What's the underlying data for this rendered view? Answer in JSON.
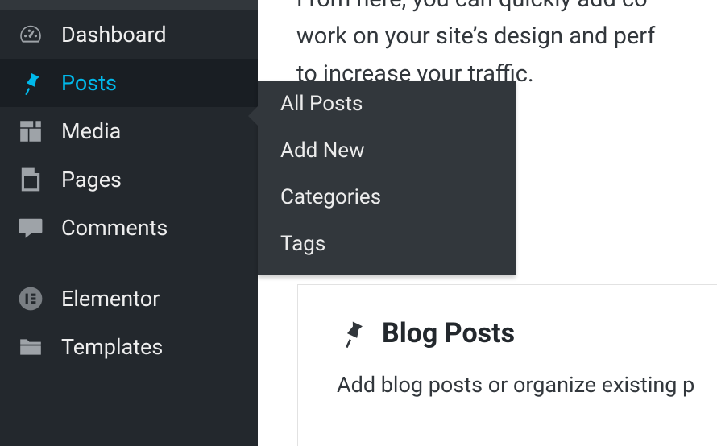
{
  "sidebar": {
    "items": [
      {
        "label": "Dashboard"
      },
      {
        "label": "Posts"
      },
      {
        "label": "Media"
      },
      {
        "label": "Pages"
      },
      {
        "label": "Comments"
      },
      {
        "label": "Elementor"
      },
      {
        "label": "Templates"
      }
    ]
  },
  "submenu": {
    "items": [
      "All Posts",
      "Add New",
      "Categories",
      "Tags"
    ]
  },
  "intro": {
    "line1": "From here, you can quickly add co",
    "line2": "work on your site’s design and perf",
    "line3": "to increase your traffic."
  },
  "card": {
    "title": "Blog Posts",
    "desc": "Add blog posts or organize existing p"
  }
}
